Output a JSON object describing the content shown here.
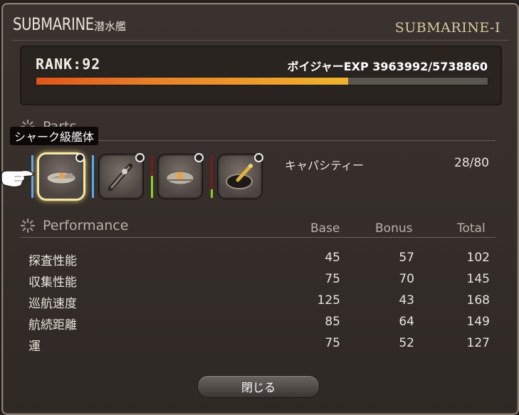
{
  "window": {
    "title_en": "SUBMARINE",
    "title_jp": "潜水艦",
    "name": "SUBMARINE-Ⅰ"
  },
  "rank": {
    "label": "RANK:92",
    "exp_label": "ボイジャーEXP 3963992/5738860",
    "exp_progress": 0.691
  },
  "parts": {
    "section_label": "Parts",
    "tooltip": "シャーク級艦体",
    "slots": [
      {
        "icon": "hull-part-icon",
        "selected": true
      },
      {
        "icon": "stern-part-icon",
        "selected": false
      },
      {
        "icon": "bow-part-icon",
        "selected": false
      },
      {
        "icon": "bridge-part-icon",
        "selected": false
      }
    ],
    "capacity_label": "キャパシティー",
    "capacity_value": "28/80"
  },
  "performance": {
    "section_label": "Performance",
    "headers": {
      "base": "Base",
      "bonus": "Bonus",
      "total": "Total"
    },
    "rows": [
      {
        "name": "探査性能",
        "base": "45",
        "bonus": "57",
        "total": "102"
      },
      {
        "name": "収集性能",
        "base": "75",
        "bonus": "70",
        "total": "145"
      },
      {
        "name": "巡航速度",
        "base": "125",
        "bonus": "43",
        "total": "168"
      },
      {
        "name": "航続距離",
        "base": "85",
        "bonus": "64",
        "total": "149"
      },
      {
        "name": "運",
        "base": "75",
        "bonus": "52",
        "total": "127"
      }
    ]
  },
  "close_label": "閉じる",
  "colors": {
    "exp_bar_start": "#e0561a",
    "exp_bar_end": "#f1b42c",
    "selected_slot": "#f4e7a8",
    "slot_separator_blue": "#5aa9f0",
    "slot_separator_green": "#8ccf2a"
  }
}
